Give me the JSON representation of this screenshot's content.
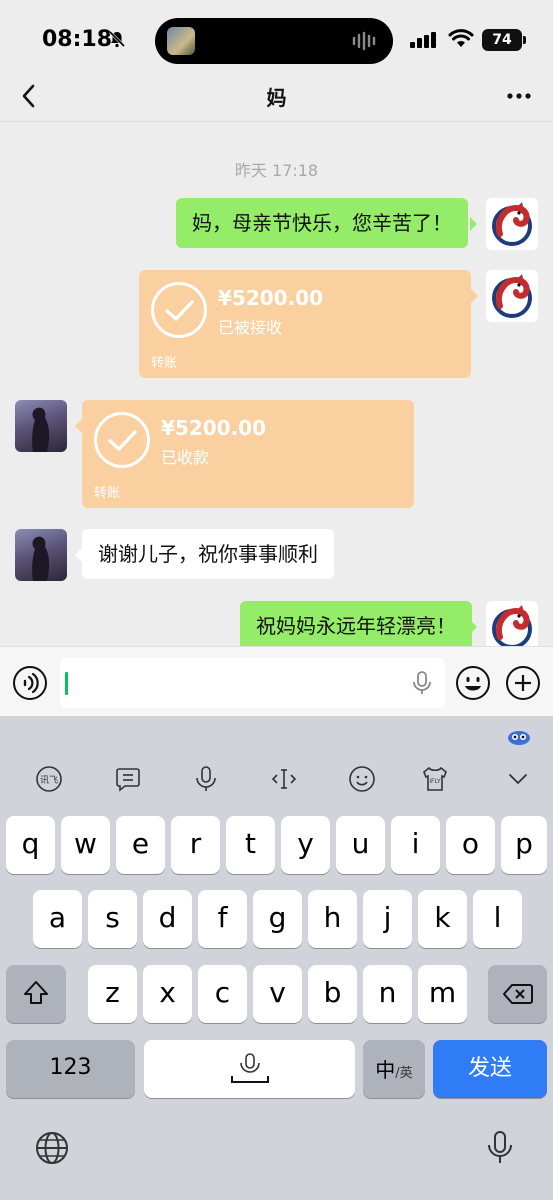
{
  "status_bar": {
    "time": "08:18",
    "battery": "74"
  },
  "nav": {
    "title": "妈"
  },
  "chat": {
    "timestamp": "昨天 17:18",
    "messages": [
      {
        "from": "me",
        "type": "text",
        "text": "妈，母亲节快乐，您辛苦了！"
      },
      {
        "from": "me",
        "type": "transfer",
        "amount": "¥5200.00",
        "status": "已被接收",
        "tag": "转账"
      },
      {
        "from": "mom",
        "type": "transfer",
        "amount": "¥5200.00",
        "status": "已收款",
        "tag": "转账"
      },
      {
        "from": "mom",
        "type": "text",
        "text": "谢谢儿子，祝你事事顺利"
      },
      {
        "from": "me",
        "type": "text",
        "text": "祝妈妈永远年轻漂亮！"
      }
    ]
  },
  "keyboard": {
    "row1": [
      "q",
      "w",
      "e",
      "r",
      "t",
      "y",
      "u",
      "i",
      "o",
      "p"
    ],
    "row2": [
      "a",
      "s",
      "d",
      "f",
      "g",
      "h",
      "j",
      "k",
      "l"
    ],
    "row3": [
      "z",
      "x",
      "c",
      "v",
      "b",
      "n",
      "m"
    ],
    "numbers_key": "123",
    "lang_key_main": "中",
    "lang_key_sub": "/英",
    "send_key": "发送",
    "toolbar_ifly": "iFLY",
    "toolbar_xunfei": "讯飞"
  },
  "colors": {
    "accent_green": "#95ec69",
    "transfer_orange": "#fbd0a0",
    "send_blue": "#2f7cf6",
    "caret_green": "#07c160"
  }
}
